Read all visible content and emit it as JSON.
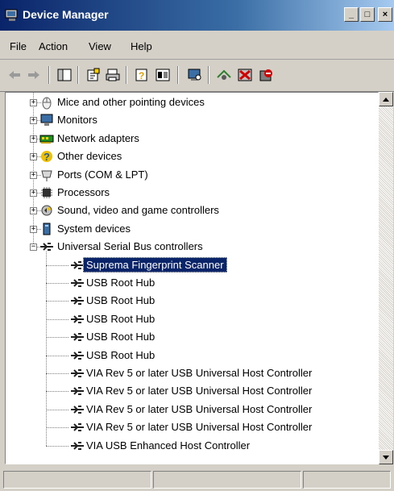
{
  "window": {
    "title": "Device Manager"
  },
  "titlebar_buttons": {
    "minimize": "_",
    "maximize": "□",
    "close": "×"
  },
  "menu": [
    "File",
    "Action",
    "View",
    "Help"
  ],
  "toolbar_icons": [
    "back-arrow-icon",
    "forward-arrow-icon",
    "console-tree-icon",
    "properties-icon",
    "print-icon",
    "help-icon",
    "view-icon",
    "scan-hardware-icon",
    "update-driver-icon",
    "uninstall-icon",
    "disable-icon"
  ],
  "tree": {
    "categories": [
      {
        "label": "Mice and other pointing devices",
        "icon": "mouse-icon",
        "expanded": false
      },
      {
        "label": "Monitors",
        "icon": "monitor-icon",
        "expanded": false
      },
      {
        "label": "Network adapters",
        "icon": "network-adapter-icon",
        "expanded": false
      },
      {
        "label": "Other devices",
        "icon": "unknown-device-icon",
        "expanded": false
      },
      {
        "label": "Ports (COM & LPT)",
        "icon": "port-icon",
        "expanded": false
      },
      {
        "label": "Processors",
        "icon": "processor-icon",
        "expanded": false
      },
      {
        "label": "Sound, video and game controllers",
        "icon": "sound-icon",
        "expanded": false
      },
      {
        "label": "System devices",
        "icon": "system-device-icon",
        "expanded": false
      },
      {
        "label": "Universal Serial Bus controllers",
        "icon": "usb-icon",
        "expanded": true
      }
    ],
    "usb_children": [
      {
        "label": "Suprema Fingerprint Scanner",
        "selected": true
      },
      {
        "label": "USB Root Hub",
        "selected": false
      },
      {
        "label": "USB Root Hub",
        "selected": false
      },
      {
        "label": "USB Root Hub",
        "selected": false
      },
      {
        "label": "USB Root Hub",
        "selected": false
      },
      {
        "label": "USB Root Hub",
        "selected": false
      },
      {
        "label": "VIA Rev 5 or later USB Universal Host Controller",
        "selected": false
      },
      {
        "label": "VIA Rev 5 or later USB Universal Host Controller",
        "selected": false
      },
      {
        "label": "VIA Rev 5 or later USB Universal Host Controller",
        "selected": false
      },
      {
        "label": "VIA Rev 5 or later USB Universal Host Controller",
        "selected": false
      },
      {
        "label": "VIA USB Enhanced Host Controller",
        "selected": false
      }
    ]
  },
  "colors": {
    "selection": "#0a246a",
    "titlebar": "#0a246a",
    "face": "#d4d0c8"
  }
}
